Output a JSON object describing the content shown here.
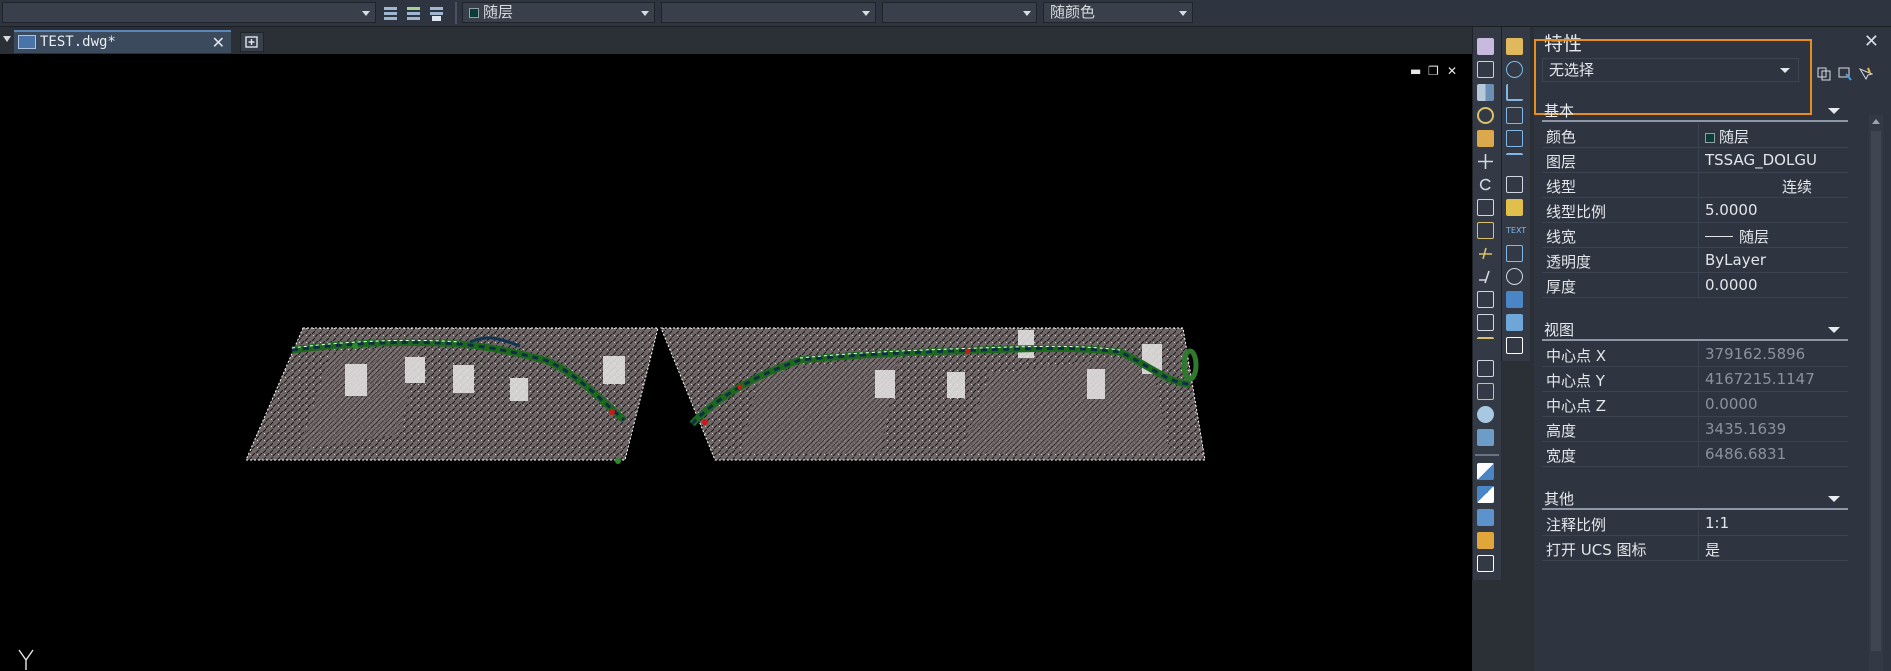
{
  "toolbar": {
    "layer_combo": "随层",
    "linetype_combo": "",
    "lineweight_combo": "",
    "color_combo": "随颜色"
  },
  "tabs": [
    {
      "label": "TEST.dwg*",
      "icon": "dwg-file-icon"
    }
  ],
  "canvas": {
    "window_controls": [
      "minimize-icon",
      "restore-icon",
      "close-icon"
    ],
    "ucs_label": "Y"
  },
  "properties_panel": {
    "title": "特性",
    "selection": "无选择",
    "sections": {
      "basic": {
        "title": "基本",
        "rows": [
          {
            "key": "颜色",
            "value": "随层"
          },
          {
            "key": "图层",
            "value": "TSSAG_DOLGU"
          },
          {
            "key": "线型",
            "value": "连续"
          },
          {
            "key": "线型比例",
            "value": "5.0000"
          },
          {
            "key": "线宽",
            "value": "随层"
          },
          {
            "key": "透明度",
            "value": "ByLayer"
          },
          {
            "key": "厚度",
            "value": "0.0000"
          }
        ]
      },
      "view": {
        "title": "视图",
        "rows": [
          {
            "key": "中心点 X",
            "value": "379162.5896"
          },
          {
            "key": "中心点 Y",
            "value": "4167215.1147"
          },
          {
            "key": "中心点 Z",
            "value": "0.0000"
          },
          {
            "key": "高度",
            "value": "3435.1639"
          },
          {
            "key": "宽度",
            "value": "6486.6831"
          }
        ]
      },
      "other": {
        "title": "其他",
        "rows": [
          {
            "key": "注释比例",
            "value": "1:1"
          },
          {
            "key": "打开 UCS 图标",
            "value": "是"
          }
        ]
      }
    }
  },
  "colors": {
    "highlight": "#e88e1f",
    "canvas": "#000000",
    "panel_bg": "#2f3540",
    "layer_swatch": "#0d3b3a"
  }
}
